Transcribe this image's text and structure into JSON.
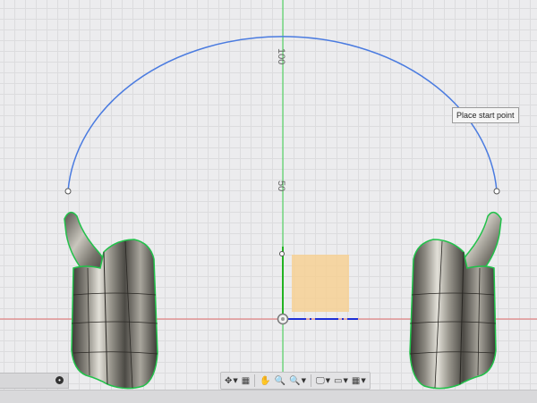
{
  "viewport": {
    "ruler_labels": [
      "100",
      "50"
    ],
    "tooltip": "Place start point",
    "colors": {
      "arc": "#4a7be0",
      "x_axis": "#e06a6a",
      "y_axis": "#39d04a",
      "sketch_blue": "#1f2fd6",
      "sketch_green": "#22b322",
      "profile_fill": "#f7cf8f",
      "grid_bg": "#ececee"
    }
  },
  "nav_toolbar": {
    "items": [
      {
        "icon": "orbit-icon",
        "glyph": "✥",
        "caret": true
      },
      {
        "icon": "look-at-icon",
        "glyph": "▦",
        "caret": false
      },
      {
        "icon": "pan-icon",
        "glyph": "✋",
        "caret": false
      },
      {
        "icon": "zoom-icon",
        "glyph": "🔍",
        "caret": false
      },
      {
        "icon": "zoom-window-icon",
        "glyph": "🔍",
        "caret": true
      },
      {
        "icon": "display-settings-icon",
        "glyph": "🖵",
        "caret": true
      },
      {
        "icon": "visual-style-icon",
        "glyph": "▭",
        "caret": true
      },
      {
        "icon": "grid-settings-icon",
        "glyph": "▦",
        "caret": true
      }
    ]
  },
  "left_panel": {
    "icon": "settings-dot-icon",
    "glyph": "⚙"
  }
}
